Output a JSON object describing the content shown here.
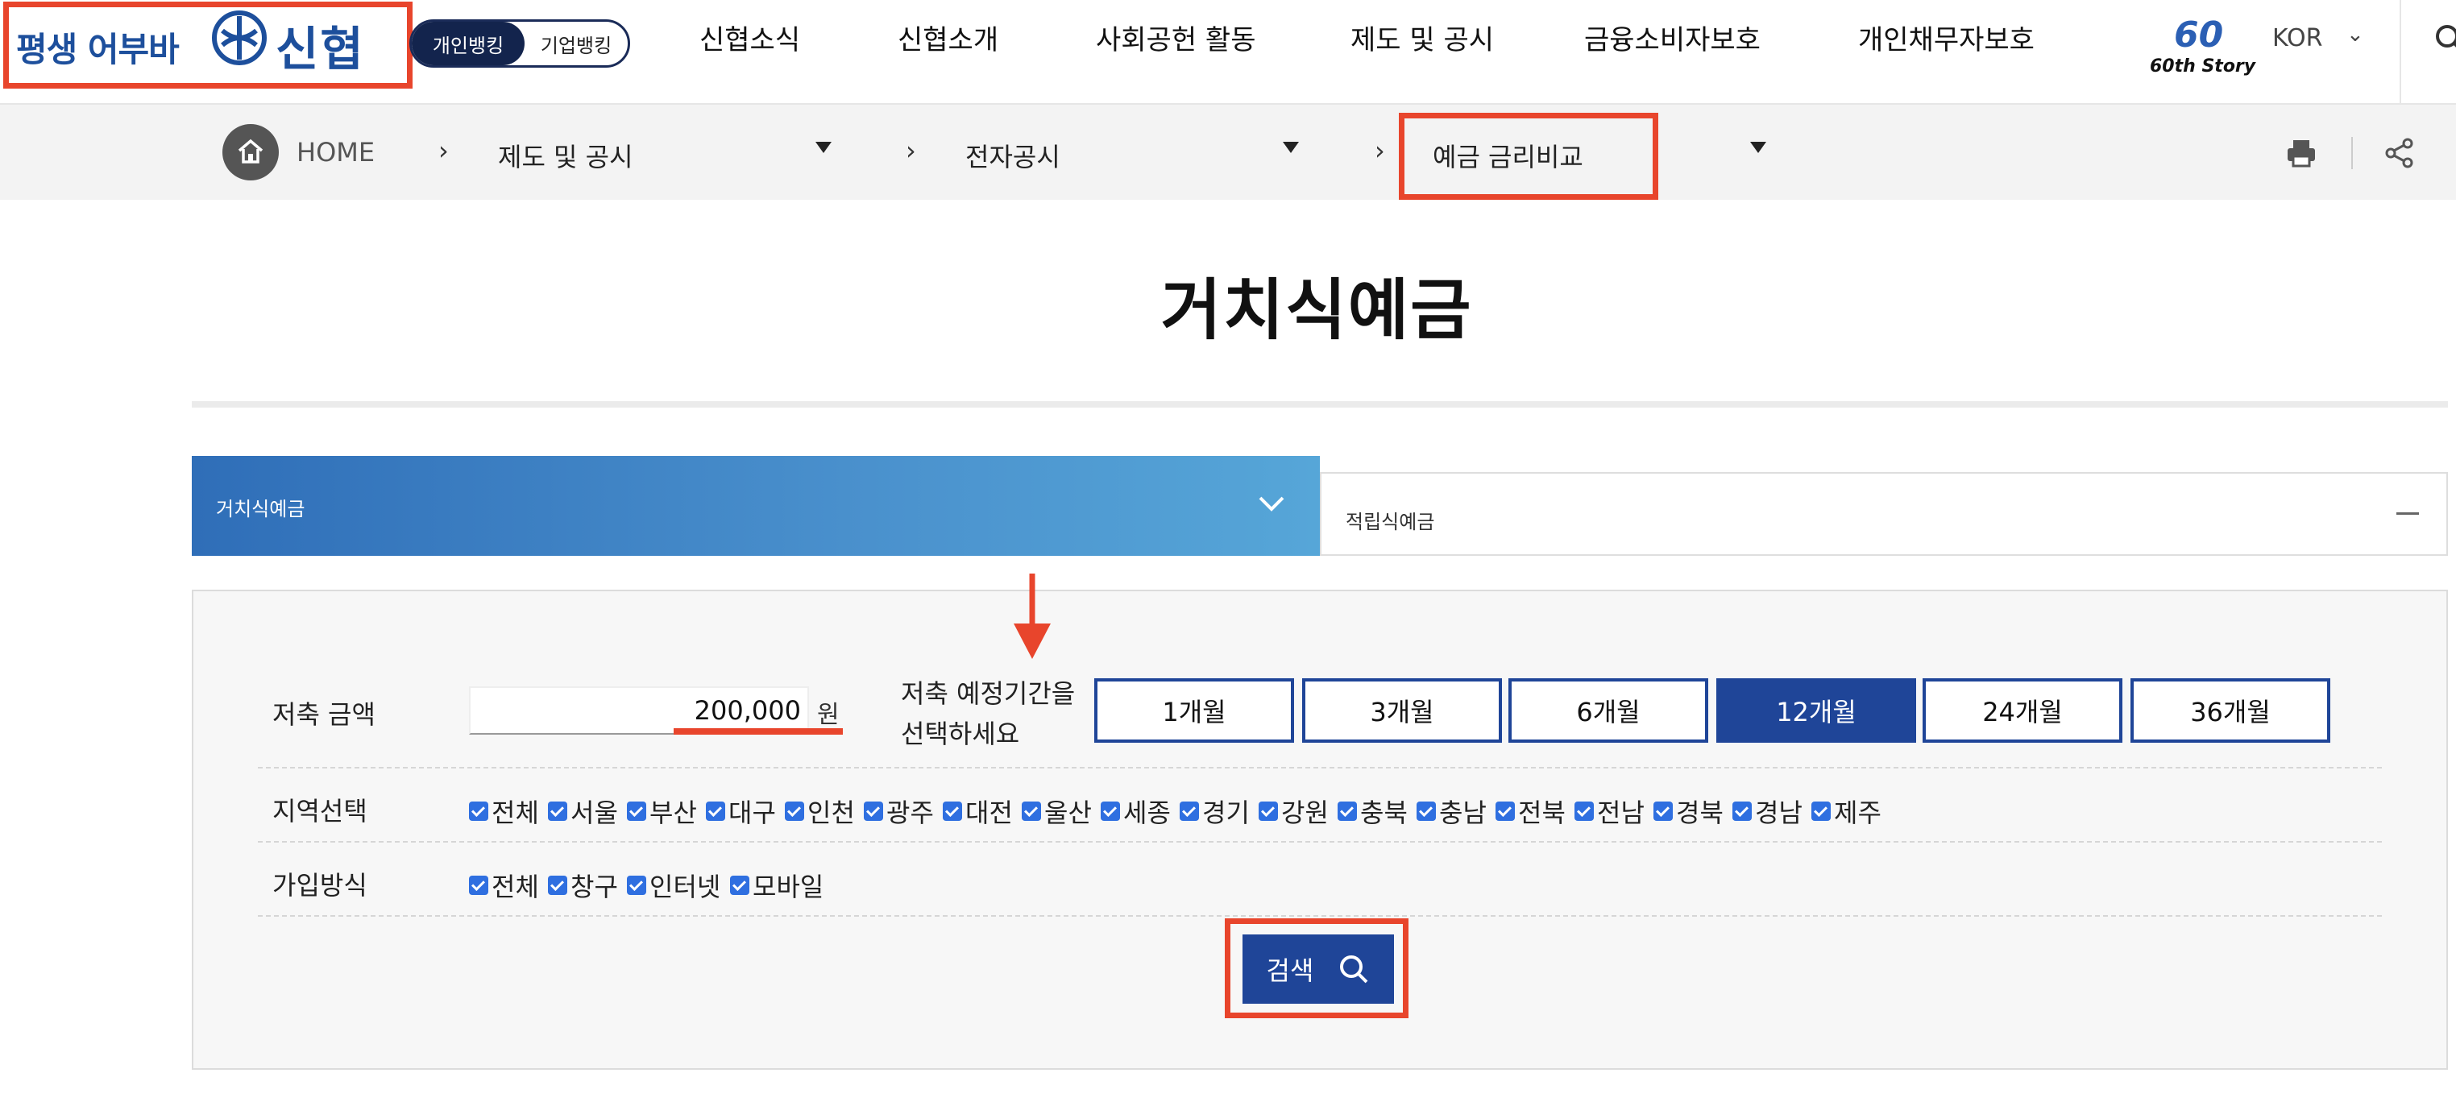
{
  "header": {
    "logo_slogan": "평생 어부바",
    "logo_name": "신협",
    "bank_toggle": {
      "personal": "개인뱅킹",
      "corporate": "기업뱅킹"
    },
    "nav": [
      "신협소식",
      "신협소개",
      "사회공헌 활동",
      "제도 및 공시",
      "금융소비자보호",
      "개인채무자보호"
    ],
    "story_number": "60",
    "story_label": "60th Story",
    "language": "KOR"
  },
  "breadcrumb": {
    "home": "HOME",
    "level1": "제도 및 공시",
    "level2": "전자공시",
    "level3": "예금 금리비교"
  },
  "page": {
    "title": "거치식예금"
  },
  "tabs": {
    "active": "거치식예금",
    "inactive": "적립식예금"
  },
  "form": {
    "amount_label": "저축 금액",
    "amount_value": "200,000",
    "amount_unit": "원",
    "period_label_line1": "저축 예정기간을",
    "period_label_line2": "선택하세요",
    "periods": [
      "1개월",
      "3개월",
      "6개월",
      "12개월",
      "24개월",
      "36개월"
    ],
    "selected_period": "12개월",
    "region_label": "지역선택",
    "regions": [
      "전체",
      "서울",
      "부산",
      "대구",
      "인천",
      "광주",
      "대전",
      "울산",
      "세종",
      "경기",
      "강원",
      "충북",
      "충남",
      "전북",
      "전남",
      "경북",
      "경남",
      "제주"
    ],
    "join_label": "가입방식",
    "join_methods": [
      "전체",
      "창구",
      "인터넷",
      "모바일"
    ],
    "search_button": "검색"
  },
  "colors": {
    "brand_blue": "#1f4598",
    "highlight_red": "#e8452c",
    "checkbox_blue": "#2f6fe0"
  }
}
